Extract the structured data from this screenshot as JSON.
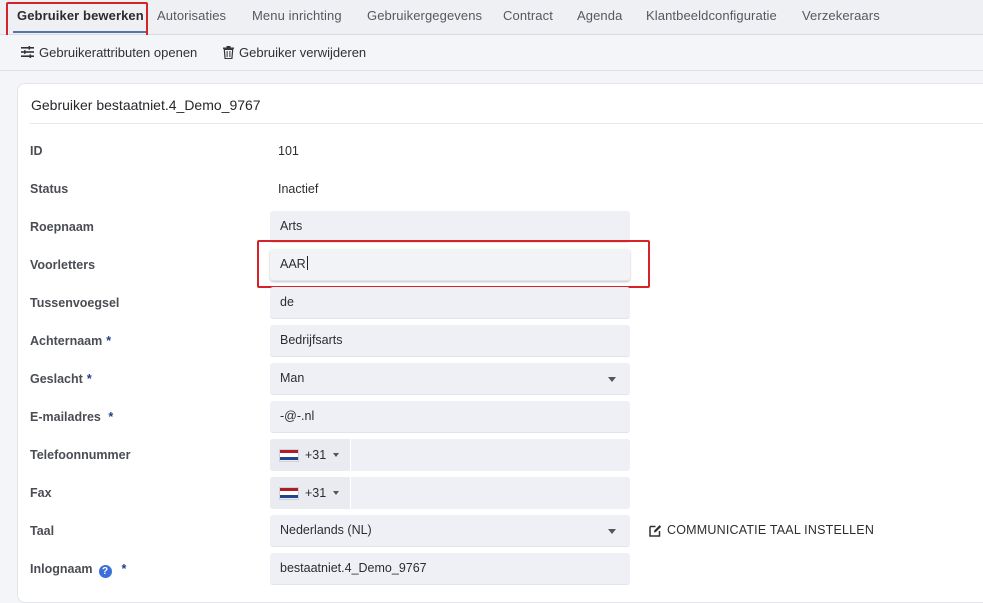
{
  "tabs": [
    {
      "label": "Gebruiker bewerken",
      "active": true
    },
    {
      "label": "Autorisaties"
    },
    {
      "label": "Menu inrichting"
    },
    {
      "label": "Gebruikergegevens"
    },
    {
      "label": "Contract"
    },
    {
      "label": "Agenda"
    },
    {
      "label": "Klantbeeldconfiguratie"
    },
    {
      "label": "Verzekeraars"
    }
  ],
  "toolbar": {
    "open_attributes": "Gebruikerattributen openen",
    "delete_user": "Gebruiker verwijderen"
  },
  "card": {
    "title": "Gebruiker bestaatniet.4_Demo_9767"
  },
  "fields": {
    "id": {
      "label": "ID",
      "value": "101"
    },
    "status": {
      "label": "Status",
      "value": "Inactief"
    },
    "roepnaam": {
      "label": "Roepnaam",
      "value": "Arts"
    },
    "voorletters": {
      "label": "Voorletters",
      "value": "AAR"
    },
    "tussenvoegsel": {
      "label": "Tussenvoegsel",
      "value": "de"
    },
    "achternaam": {
      "label": "Achternaam",
      "required": "*",
      "value": "Bedrijfsarts"
    },
    "geslacht": {
      "label": "Geslacht",
      "required": "*",
      "value": "Man"
    },
    "email": {
      "label": "E-mailadres",
      "required": "*",
      "value": "-@-.nl"
    },
    "telefoon": {
      "label": "Telefoonnummer",
      "prefix": "+31",
      "value": ""
    },
    "fax": {
      "label": "Fax",
      "prefix": "+31",
      "value": ""
    },
    "taal": {
      "label": "Taal",
      "value": "Nederlands (NL)"
    },
    "inlognaam": {
      "label": "Inlognaam",
      "help": "?",
      "required": "*",
      "value": "bestaatniet.4_Demo_9767"
    }
  },
  "comm_language_button": "COMMUNICATIE TAAL INSTELLEN",
  "colors": {
    "highlight": "#d6232a",
    "tab_underline": "#5674a6",
    "required_star": "#1f3f8a",
    "help_icon": "#3e6fd8",
    "flag_nl": [
      "#ae1c28",
      "#ffffff",
      "#21468b"
    ]
  },
  "icons": {
    "toolbar_open": "tune-icon",
    "toolbar_delete": "trash-icon",
    "comm_link": "edit-icon",
    "help": "question-circle-icon"
  }
}
